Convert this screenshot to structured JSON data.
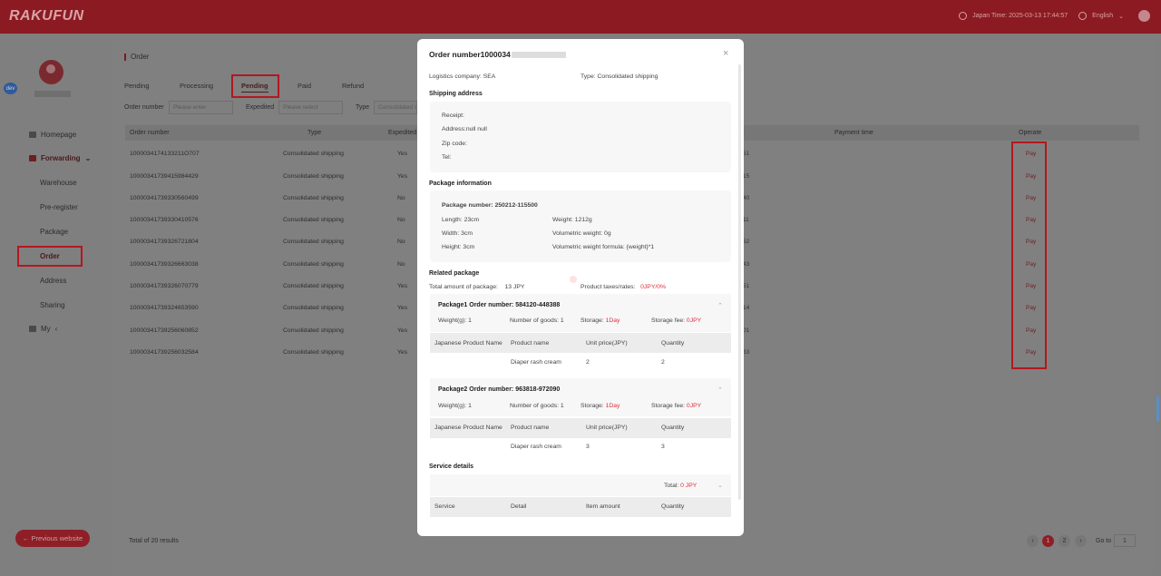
{
  "header": {
    "logo": "RAKUFUN",
    "japan_time": "Japan Time: 2025-03-13 17:44:57",
    "language": "English"
  },
  "sidebar": {
    "dev_badge": "dev",
    "items": [
      {
        "label": "Homepage"
      },
      {
        "label": "Forwarding"
      },
      {
        "label": "Warehouse"
      },
      {
        "label": "Pre-register"
      },
      {
        "label": "Package"
      },
      {
        "label": "Order"
      },
      {
        "label": "Address"
      },
      {
        "label": "Sharing"
      },
      {
        "label": "My"
      }
    ],
    "previous_website": "← Previous website"
  },
  "main": {
    "breadcrumb": "Order",
    "tabs": [
      "Pending",
      "Processing",
      "Pending",
      "Paid",
      "Refund"
    ],
    "active_tab": "Pending",
    "filters": {
      "order_number_label": "Order number",
      "order_number_placeholder": "Please enter",
      "expedited_label": "Expedited",
      "expedited_placeholder": "Please select",
      "type_label": "Type",
      "type_value": "Consolidated s"
    },
    "columns": [
      "Order number",
      "Type",
      "Expedited",
      "Payment time",
      "Operate"
    ],
    "rows": [
      {
        "order": "1000034174133211O707",
        "type": "Consolidated shipping",
        "expedited": "Yes",
        "edge": "51",
        "op": "Pay"
      },
      {
        "order": "100003417394159844​29",
        "type": "Consolidated shipping",
        "expedited": "Yes",
        "edge": "15",
        "op": "Pay"
      },
      {
        "order": "10000341739330560499",
        "type": "Consolidated shipping",
        "expedited": "No",
        "edge": "40",
        "op": "Pay"
      },
      {
        "order": "10000341739330410576",
        "type": "Consolidated shipping",
        "expedited": "No",
        "edge": "11",
        "op": "Pay"
      },
      {
        "order": "10000341739326721804",
        "type": "Consolidated shipping",
        "expedited": "No",
        "edge": "52",
        "op": "Pay"
      },
      {
        "order": "10000341739326663038",
        "type": "Consolidated shipping",
        "expedited": "No",
        "edge": "43",
        "op": "Pay"
      },
      {
        "order": "10000341739326070779",
        "type": "Consolidated shipping",
        "expedited": "Yes",
        "edge": "51",
        "op": "Pay"
      },
      {
        "order": "10000341739324653590",
        "type": "Consolidated shipping",
        "expedited": "Yes",
        "edge": "14",
        "op": "Pay"
      },
      {
        "order": "10000341739256060852",
        "type": "Consolidated shipping",
        "expedited": "Yes",
        "edge": "01",
        "op": "Pay"
      },
      {
        "order": "10000341739256032584",
        "type": "Consolidated shipping",
        "expedited": "Yes",
        "edge": "33",
        "op": "Pay"
      }
    ],
    "total_results": "Total of 20 results",
    "pagination": {
      "prev": "‹",
      "pages": [
        "1",
        "2"
      ],
      "next": "›",
      "goto_label": "Go to",
      "goto_value": "1"
    }
  },
  "modal": {
    "title": "Order number1000034",
    "close": "×",
    "logistics_label": "Logistics company:",
    "logistics_value": "SEA",
    "type_label": "Type:",
    "type_value": "Consolidated shipping",
    "shipping_address_title": "Shipping address",
    "receipt": "Receipt:",
    "address": "Address:null null",
    "zip": "Zip code:",
    "tel": "Tel:",
    "package_info_title": "Package information",
    "package_number_label": "Package number:",
    "package_number_value": "250212-115500",
    "length": "Length: 23cm",
    "weight": "Weight: 1212g",
    "width": "Width: 3cm",
    "vol_weight": "Volumetric weight: 0g",
    "height": "Height: 3cm",
    "vol_formula": "Volumetric weight formula: {weight}*1",
    "related_title": "Related package",
    "total_amount_label": "Total amount of package:",
    "total_amount_value": "13 JPY",
    "taxes_label": "Product taxes/rates:",
    "taxes_value": "0JPY/0%",
    "packages": [
      {
        "title": "Package1 Order number:",
        "number": "584120-448388",
        "weight": "Weight(g): 1",
        "goods": "Number of goods: 1",
        "storage_label": "Storage:",
        "storage_value": "1Day",
        "fee_label": "Storage fee:",
        "fee_value": "0JPY",
        "cols": [
          "Japanese Product Name",
          "Product name",
          "Unit price(JPY)",
          "Quantity"
        ],
        "row": [
          "",
          "Diaper rash cream",
          "2",
          "2"
        ]
      },
      {
        "title": "Package2 Order number:",
        "number": "963818-972090",
        "weight": "Weight(g): 1",
        "goods": "Number of goods: 1",
        "storage_label": "Storage:",
        "storage_value": "1Day",
        "fee_label": "Storage fee:",
        "fee_value": "0JPY",
        "cols": [
          "Japanese Product Name",
          "Product name",
          "Unit price(JPY)",
          "Quantity"
        ],
        "row": [
          "",
          "Diaper rash cream",
          "3",
          "3"
        ]
      }
    ],
    "service_title": "Service details",
    "service_total_label": "Total:",
    "service_total_value": "0 JPY",
    "service_cols": [
      "Service",
      "Detail",
      "Item amount",
      "Quantity"
    ]
  },
  "colors": {
    "brand": "#b3171f",
    "accent_red": "#e02c3a"
  }
}
